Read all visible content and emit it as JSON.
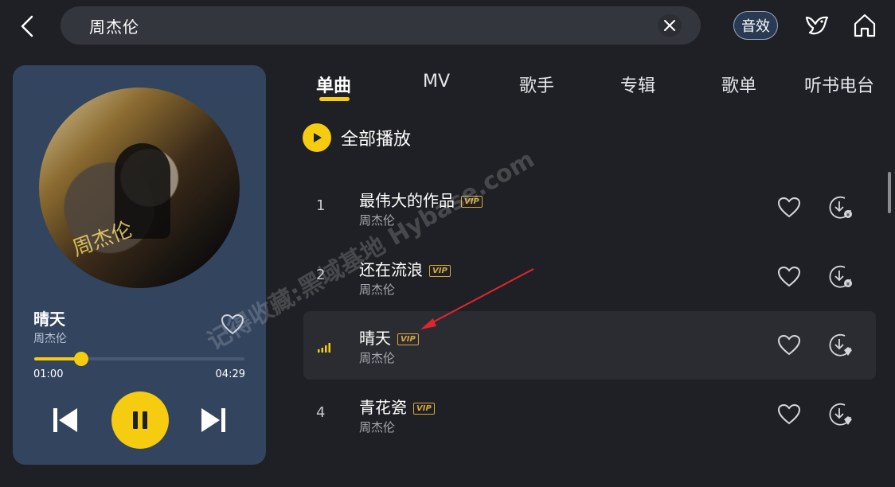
{
  "search": {
    "query": "周杰伦"
  },
  "header": {
    "sound_effect_label": "音效"
  },
  "colors": {
    "accent": "#f5cc10",
    "panel": "#33445e",
    "background": "#1f2025",
    "vip": "#d6a73a"
  },
  "now_playing": {
    "title": "晴天",
    "artist": "周杰伦",
    "current_time": "01:00",
    "total_time": "04:29",
    "progress": 0.223
  },
  "tabs": [
    {
      "label": "单曲",
      "active": true
    },
    {
      "label": "MV",
      "active": false
    },
    {
      "label": "歌手",
      "active": false
    },
    {
      "label": "专辑",
      "active": false
    },
    {
      "label": "歌单",
      "active": false
    },
    {
      "label": "听书电台",
      "active": false
    }
  ],
  "play_all_label": "全部播放",
  "songs": [
    {
      "index": "1",
      "title": "最伟大的作品",
      "vip": "VIP",
      "artist": "周杰伦",
      "playing": false
    },
    {
      "index": "2",
      "title": "还在流浪",
      "vip": "VIP",
      "artist": "周杰伦",
      "playing": false
    },
    {
      "index": "",
      "title": "晴天",
      "vip": "VIP",
      "artist": "周杰伦",
      "playing": true
    },
    {
      "index": "4",
      "title": "青花瓷",
      "vip": "VIP",
      "artist": "周杰伦",
      "playing": false
    }
  ],
  "icons": {
    "back": "chevron-left-icon",
    "clear": "close-icon",
    "bird": "bird-icon",
    "home": "home-icon",
    "heart": "heart-icon",
    "download": "download-icon",
    "play": "play-icon",
    "pause": "pause-icon",
    "prev": "skip-previous-icon",
    "next": "skip-next-icon",
    "eq": "equalizer-icon"
  },
  "watermark": "记得收藏:黑域基地 Hybase.com"
}
